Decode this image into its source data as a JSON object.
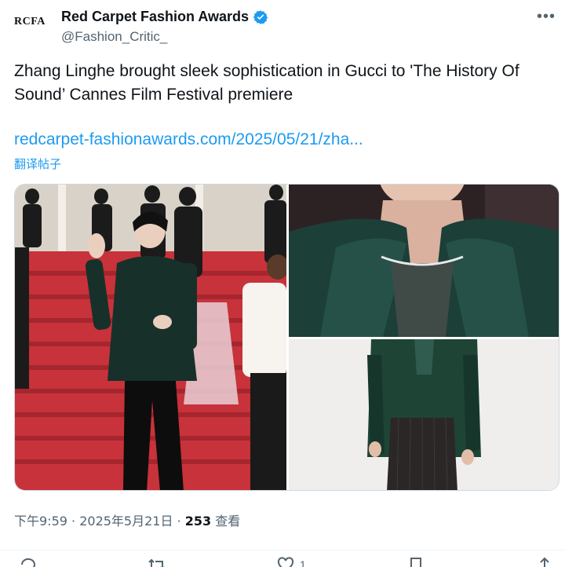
{
  "tweet": {
    "account_name": "Red Carpet Fashion Awards",
    "handle": "@Fashion_Critic_",
    "avatar_text": "RCFA",
    "verified": true,
    "text": "Zhang Linghe brought sleek sophistication in Gucci to 'The History Of Sound’ Cannes Film Festival premiere",
    "link": "redcarpet-fashionawards.com/2025/05/21/zha...",
    "translate_label": "翻译帖子",
    "time": "下午9:59",
    "date": "2025年5月21日",
    "views_count": "253",
    "views_label": "查看",
    "reply_count": "",
    "like_count": "1",
    "more_icon": "more-dots-icon"
  },
  "colors": {
    "accent": "#1d9bf0",
    "text": "#0f1419",
    "secondary": "#536471"
  }
}
